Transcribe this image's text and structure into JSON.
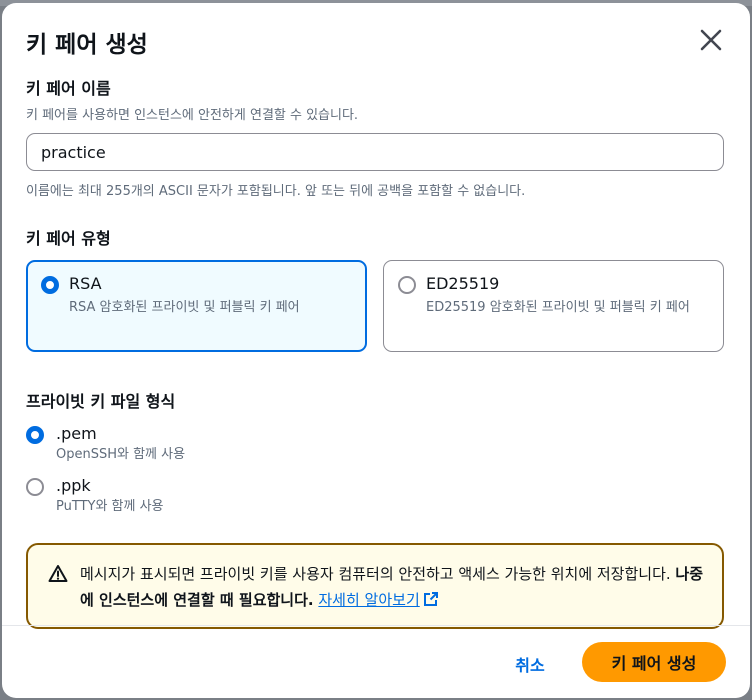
{
  "dialog": {
    "title": "키 페어 생성"
  },
  "name_field": {
    "label": "키 페어 이름",
    "description": "키 페어를 사용하면 인스턴스에 안전하게 연결할 수 있습니다.",
    "value": "practice",
    "hint": "이름에는 최대 255개의 ASCII 문자가 포함됩니다. 앞 또는 뒤에 공백을 포함할 수 없습니다."
  },
  "key_type": {
    "label": "키 페어 유형",
    "options": [
      {
        "title": "RSA",
        "description": "RSA 암호화된 프라이빗 및 퍼블릭 키 페어",
        "selected": true
      },
      {
        "title": "ED25519",
        "description": "ED25519 암호화된 프라이빗 및 퍼블릭 키 페어",
        "selected": false
      }
    ]
  },
  "file_format": {
    "label": "프라이빗 키 파일 형식",
    "options": [
      {
        "title": ".pem",
        "description": "OpenSSH와 함께 사용",
        "selected": true
      },
      {
        "title": ".ppk",
        "description": "PuTTY와 함께 사용",
        "selected": false
      }
    ]
  },
  "alert": {
    "text": "메시지가 표시되면 프라이빗 키를 사용자 컴퓨터의 안전하고 액세스 가능한 위치에 저장합니다. ",
    "bold": "나중에 인스턴스에 연결할 때 필요합니다.",
    "link": "자세히 알아보기",
    "border_color": "#855900",
    "background_color": "#fffce9"
  },
  "footer": {
    "cancel_label": "취소",
    "create_label": "키 페어 생성",
    "primary_color": "#ff9900"
  },
  "icons": {
    "close": "close-icon",
    "warning": "warning-icon",
    "external": "external-link-icon"
  }
}
